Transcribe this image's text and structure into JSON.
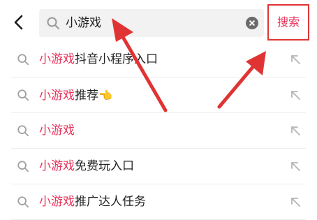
{
  "search": {
    "query": "小游戏",
    "button_label": "搜索"
  },
  "suggestions": [
    {
      "highlight": "小游戏",
      "rest": "抖音小程序入口",
      "emoji": ""
    },
    {
      "highlight": "小游戏",
      "rest": "推荐",
      "emoji": "👈"
    },
    {
      "highlight": "小游戏",
      "rest": "",
      "emoji": ""
    },
    {
      "highlight": "小游戏",
      "rest": "免费玩入口",
      "emoji": ""
    },
    {
      "highlight": "小游戏",
      "rest": "推广达人任务",
      "emoji": ""
    }
  ],
  "colors": {
    "accent": "#e8325a",
    "annotation": "#e03434",
    "search_bg": "#f2f2f3"
  },
  "icons": [
    "back-arrow-icon",
    "search-icon",
    "clear-icon",
    "fill-arrow-icon"
  ]
}
